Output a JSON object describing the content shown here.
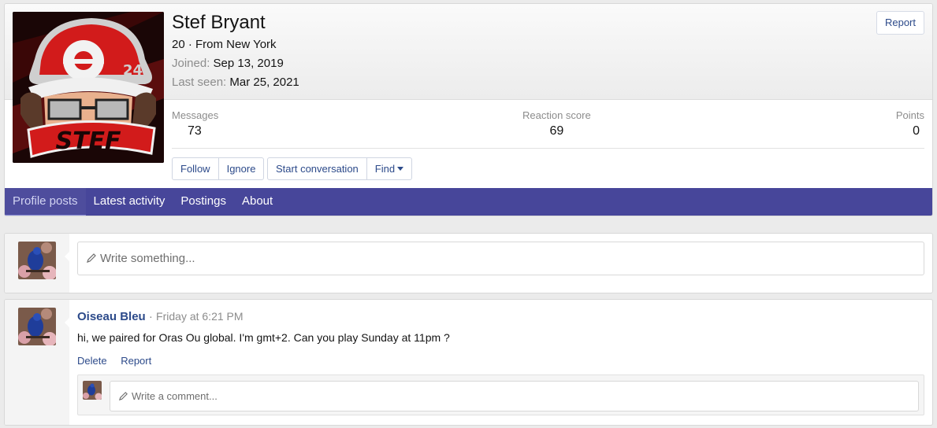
{
  "profile": {
    "name": "Stef Bryant",
    "age_location": "20 · From New York",
    "joined_label": "Joined:",
    "joined_value": "Sep 13, 2019",
    "last_seen_label": "Last seen:",
    "last_seen_value": "Mar 25, 2021",
    "report_label": "Report",
    "avatar_text": "STEF",
    "avatar_number": "24"
  },
  "stats": {
    "messages_label": "Messages",
    "messages_value": "73",
    "reaction_label": "Reaction score",
    "reaction_value": "69",
    "points_label": "Points",
    "points_value": "0"
  },
  "actions": {
    "follow": "Follow",
    "ignore": "Ignore",
    "start_conversation": "Start conversation",
    "find": "Find"
  },
  "tabs": [
    {
      "label": "Profile posts",
      "active": true
    },
    {
      "label": "Latest activity",
      "active": false
    },
    {
      "label": "Postings",
      "active": false
    },
    {
      "label": "About",
      "active": false
    }
  ],
  "new_post": {
    "placeholder": "Write something..."
  },
  "post": {
    "author": "Oiseau Bleu",
    "separator": "·",
    "time": "Friday at 6:21 PM",
    "body": "hi, we paired for Oras Ou global. I'm gmt+2. Can you play Sunday at 11pm ?",
    "delete_label": "Delete",
    "report_label": "Report",
    "comment_placeholder": "Write a comment..."
  },
  "colors": {
    "accent": "#47469a",
    "link": "#2c4a8a",
    "muted": "#8c8c8c"
  }
}
